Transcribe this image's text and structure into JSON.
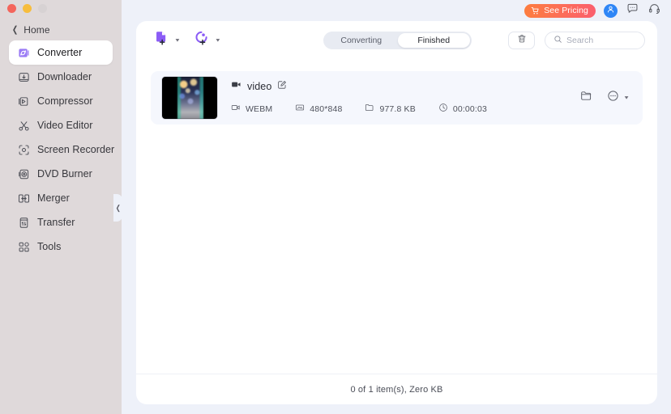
{
  "window": {
    "controls": [
      "close",
      "minimize",
      "zoom"
    ]
  },
  "sidebar": {
    "home_label": "Home",
    "back_icon": "chevron-left-icon",
    "collapse_icon": "chevron-left-icon",
    "items": [
      {
        "label": "Converter",
        "icon": "converter-icon",
        "active": true
      },
      {
        "label": "Downloader",
        "icon": "downloader-icon",
        "active": false
      },
      {
        "label": "Compressor",
        "icon": "compressor-icon",
        "active": false
      },
      {
        "label": "Video Editor",
        "icon": "scissors-icon",
        "active": false
      },
      {
        "label": "Screen Recorder",
        "icon": "screen-recorder-icon",
        "active": false
      },
      {
        "label": "DVD Burner",
        "icon": "disc-icon",
        "active": false
      },
      {
        "label": "Merger",
        "icon": "merger-icon",
        "active": false
      },
      {
        "label": "Transfer",
        "icon": "transfer-icon",
        "active": false
      },
      {
        "label": "Tools",
        "icon": "grid-icon",
        "active": false
      }
    ]
  },
  "topbar": {
    "pricing_label": "See Pricing",
    "pricing_icon": "cart-icon",
    "account_icon": "user-icon",
    "feedback_icon": "message-icon",
    "support_icon": "headset-icon",
    "pricing_color_start": "#fd7d3f",
    "pricing_color_end": "#fb5f6e",
    "account_color": "#2f86f6"
  },
  "toolbar": {
    "add_file_icon": "add-file-icon",
    "add_file_caret": "chevron-down-icon",
    "add_disc_icon": "add-disc-icon",
    "add_disc_caret": "chevron-down-icon",
    "accent_color": "#8b5cf6",
    "tabs": [
      {
        "label": "Converting",
        "active": false
      },
      {
        "label": "Finished",
        "active": true
      }
    ],
    "trash_icon": "trash-icon",
    "search": {
      "icon": "search-icon",
      "placeholder": "Search",
      "value": ""
    }
  },
  "file_list": {
    "items": [
      {
        "thumbnail": "video-thumbnail",
        "title_icon": "video-camera-icon",
        "title": "video",
        "edit_icon": "edit-pencil-icon",
        "meta": [
          {
            "icon": "video-format-icon",
            "text": "WEBM"
          },
          {
            "icon": "resolution-icon",
            "text": "480*848"
          },
          {
            "icon": "folder-size-icon",
            "text": "977.8 KB"
          },
          {
            "icon": "clock-icon",
            "text": "00:00:03"
          }
        ],
        "actions": {
          "folder_icon": "folder-icon",
          "more_icon": "more-options-icon",
          "more_caret": "chevron-down-icon"
        }
      }
    ]
  },
  "statusbar": {
    "text": "0 of 1 item(s), Zero KB"
  }
}
